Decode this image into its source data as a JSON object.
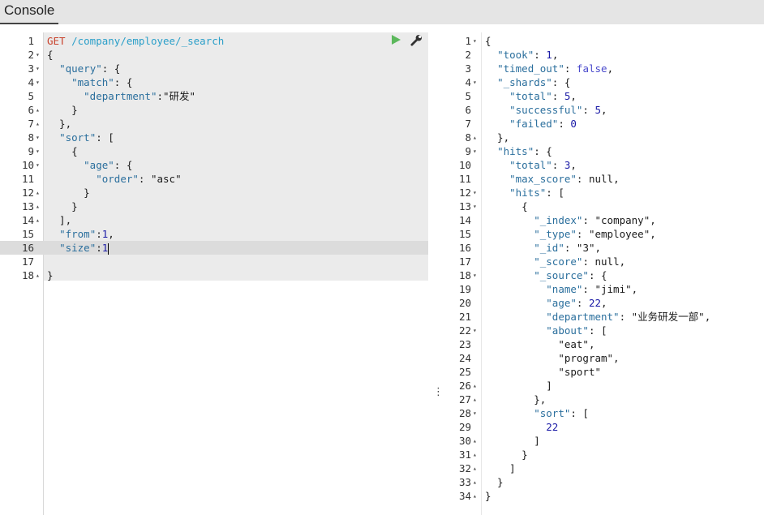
{
  "tabs": {
    "console_label": "Console"
  },
  "request": {
    "lines": [
      {
        "n": "1",
        "fold": "",
        "parts": [
          [
            "t-method",
            "GET"
          ],
          [
            "t-punc",
            " "
          ],
          [
            "t-url",
            "/company/employee/_search"
          ]
        ]
      },
      {
        "n": "2",
        "fold": "▾",
        "parts": [
          [
            "t-punc",
            "{"
          ]
        ]
      },
      {
        "n": "3",
        "fold": "▾",
        "parts": [
          [
            "t-punc",
            "  "
          ],
          [
            "t-key",
            "\"query\""
          ],
          [
            "t-punc",
            ": {"
          ]
        ]
      },
      {
        "n": "4",
        "fold": "▾",
        "parts": [
          [
            "t-punc",
            "    "
          ],
          [
            "t-key",
            "\"match\""
          ],
          [
            "t-punc",
            ": {"
          ]
        ]
      },
      {
        "n": "5",
        "fold": "",
        "parts": [
          [
            "t-punc",
            "      "
          ],
          [
            "t-key",
            "\"department\""
          ],
          [
            "t-punc",
            ":"
          ],
          [
            "t-str",
            "\"研发\""
          ]
        ]
      },
      {
        "n": "6",
        "fold": "▴",
        "parts": [
          [
            "t-punc",
            "    }"
          ]
        ]
      },
      {
        "n": "7",
        "fold": "▴",
        "parts": [
          [
            "t-punc",
            "  },"
          ]
        ]
      },
      {
        "n": "8",
        "fold": "▾",
        "parts": [
          [
            "t-punc",
            "  "
          ],
          [
            "t-key",
            "\"sort\""
          ],
          [
            "t-punc",
            ": ["
          ]
        ]
      },
      {
        "n": "9",
        "fold": "▾",
        "parts": [
          [
            "t-punc",
            "    {"
          ]
        ]
      },
      {
        "n": "10",
        "fold": "▾",
        "parts": [
          [
            "t-punc",
            "      "
          ],
          [
            "t-key",
            "\"age\""
          ],
          [
            "t-punc",
            ": {"
          ]
        ]
      },
      {
        "n": "11",
        "fold": "",
        "parts": [
          [
            "t-punc",
            "        "
          ],
          [
            "t-key",
            "\"order\""
          ],
          [
            "t-punc",
            ": "
          ],
          [
            "t-str",
            "\"asc\""
          ]
        ]
      },
      {
        "n": "12",
        "fold": "▴",
        "parts": [
          [
            "t-punc",
            "      }"
          ]
        ]
      },
      {
        "n": "13",
        "fold": "▴",
        "parts": [
          [
            "t-punc",
            "    }"
          ]
        ]
      },
      {
        "n": "14",
        "fold": "▴",
        "parts": [
          [
            "t-punc",
            "  ],"
          ]
        ]
      },
      {
        "n": "15",
        "fold": "",
        "parts": [
          [
            "t-punc",
            "  "
          ],
          [
            "t-key",
            "\"from\""
          ],
          [
            "t-punc",
            ":"
          ],
          [
            "t-num",
            "1"
          ],
          [
            "t-punc",
            ","
          ]
        ]
      },
      {
        "n": "16",
        "fold": "",
        "parts": [
          [
            "t-punc",
            "  "
          ],
          [
            "t-key",
            "\"size\""
          ],
          [
            "t-punc",
            ":"
          ],
          [
            "t-num",
            "1"
          ]
        ],
        "cursor": true,
        "highlight": true
      },
      {
        "n": "17",
        "fold": "",
        "parts": []
      },
      {
        "n": "18",
        "fold": "▴",
        "parts": [
          [
            "t-punc",
            "}"
          ]
        ]
      }
    ]
  },
  "response": {
    "lines": [
      {
        "n": "1",
        "fold": "▾",
        "parts": [
          [
            "t-punc",
            "{"
          ]
        ]
      },
      {
        "n": "2",
        "fold": "",
        "parts": [
          [
            "t-punc",
            "  "
          ],
          [
            "t-key",
            "\"took\""
          ],
          [
            "t-punc",
            ": "
          ],
          [
            "t-num",
            "1"
          ],
          [
            "t-punc",
            ","
          ]
        ]
      },
      {
        "n": "3",
        "fold": "",
        "parts": [
          [
            "t-punc",
            "  "
          ],
          [
            "t-key",
            "\"timed_out\""
          ],
          [
            "t-punc",
            ": "
          ],
          [
            "t-bool",
            "false"
          ],
          [
            "t-punc",
            ","
          ]
        ]
      },
      {
        "n": "4",
        "fold": "▾",
        "parts": [
          [
            "t-punc",
            "  "
          ],
          [
            "t-key",
            "\"_shards\""
          ],
          [
            "t-punc",
            ": {"
          ]
        ]
      },
      {
        "n": "5",
        "fold": "",
        "parts": [
          [
            "t-punc",
            "    "
          ],
          [
            "t-key",
            "\"total\""
          ],
          [
            "t-punc",
            ": "
          ],
          [
            "t-num",
            "5"
          ],
          [
            "t-punc",
            ","
          ]
        ]
      },
      {
        "n": "6",
        "fold": "",
        "parts": [
          [
            "t-punc",
            "    "
          ],
          [
            "t-key",
            "\"successful\""
          ],
          [
            "t-punc",
            ": "
          ],
          [
            "t-num",
            "5"
          ],
          [
            "t-punc",
            ","
          ]
        ]
      },
      {
        "n": "7",
        "fold": "",
        "parts": [
          [
            "t-punc",
            "    "
          ],
          [
            "t-key",
            "\"failed\""
          ],
          [
            "t-punc",
            ": "
          ],
          [
            "t-num",
            "0"
          ]
        ]
      },
      {
        "n": "8",
        "fold": "▴",
        "parts": [
          [
            "t-punc",
            "  },"
          ]
        ]
      },
      {
        "n": "9",
        "fold": "▾",
        "parts": [
          [
            "t-punc",
            "  "
          ],
          [
            "t-key",
            "\"hits\""
          ],
          [
            "t-punc",
            ": {"
          ]
        ]
      },
      {
        "n": "10",
        "fold": "",
        "parts": [
          [
            "t-punc",
            "    "
          ],
          [
            "t-key",
            "\"total\""
          ],
          [
            "t-punc",
            ": "
          ],
          [
            "t-num",
            "3"
          ],
          [
            "t-punc",
            ","
          ]
        ]
      },
      {
        "n": "11",
        "fold": "",
        "parts": [
          [
            "t-punc",
            "    "
          ],
          [
            "t-key",
            "\"max_score\""
          ],
          [
            "t-punc",
            ": "
          ],
          [
            "t-null",
            "null"
          ],
          [
            "t-punc",
            ","
          ]
        ]
      },
      {
        "n": "12",
        "fold": "▾",
        "parts": [
          [
            "t-punc",
            "    "
          ],
          [
            "t-key",
            "\"hits\""
          ],
          [
            "t-punc",
            ": ["
          ]
        ]
      },
      {
        "n": "13",
        "fold": "▾",
        "parts": [
          [
            "t-punc",
            "      {"
          ]
        ]
      },
      {
        "n": "14",
        "fold": "",
        "parts": [
          [
            "t-punc",
            "        "
          ],
          [
            "t-key",
            "\"_index\""
          ],
          [
            "t-punc",
            ": "
          ],
          [
            "t-str",
            "\"company\""
          ],
          [
            "t-punc",
            ","
          ]
        ]
      },
      {
        "n": "15",
        "fold": "",
        "parts": [
          [
            "t-punc",
            "        "
          ],
          [
            "t-key",
            "\"_type\""
          ],
          [
            "t-punc",
            ": "
          ],
          [
            "t-str",
            "\"employee\""
          ],
          [
            "t-punc",
            ","
          ]
        ]
      },
      {
        "n": "16",
        "fold": "",
        "parts": [
          [
            "t-punc",
            "        "
          ],
          [
            "t-key",
            "\"_id\""
          ],
          [
            "t-punc",
            ": "
          ],
          [
            "t-str",
            "\"3\""
          ],
          [
            "t-punc",
            ","
          ]
        ]
      },
      {
        "n": "17",
        "fold": "",
        "parts": [
          [
            "t-punc",
            "        "
          ],
          [
            "t-key",
            "\"_score\""
          ],
          [
            "t-punc",
            ": "
          ],
          [
            "t-null",
            "null"
          ],
          [
            "t-punc",
            ","
          ]
        ]
      },
      {
        "n": "18",
        "fold": "▾",
        "parts": [
          [
            "t-punc",
            "        "
          ],
          [
            "t-key",
            "\"_source\""
          ],
          [
            "t-punc",
            ": {"
          ]
        ]
      },
      {
        "n": "19",
        "fold": "",
        "parts": [
          [
            "t-punc",
            "          "
          ],
          [
            "t-key",
            "\"name\""
          ],
          [
            "t-punc",
            ": "
          ],
          [
            "t-str",
            "\"jimi\""
          ],
          [
            "t-punc",
            ","
          ]
        ]
      },
      {
        "n": "20",
        "fold": "",
        "parts": [
          [
            "t-punc",
            "          "
          ],
          [
            "t-key",
            "\"age\""
          ],
          [
            "t-punc",
            ": "
          ],
          [
            "t-num",
            "22"
          ],
          [
            "t-punc",
            ","
          ]
        ]
      },
      {
        "n": "21",
        "fold": "",
        "parts": [
          [
            "t-punc",
            "          "
          ],
          [
            "t-key",
            "\"department\""
          ],
          [
            "t-punc",
            ": "
          ],
          [
            "t-str",
            "\"业务研发一部\""
          ],
          [
            "t-punc",
            ","
          ]
        ]
      },
      {
        "n": "22",
        "fold": "▾",
        "parts": [
          [
            "t-punc",
            "          "
          ],
          [
            "t-key",
            "\"about\""
          ],
          [
            "t-punc",
            ": ["
          ]
        ]
      },
      {
        "n": "23",
        "fold": "",
        "parts": [
          [
            "t-punc",
            "            "
          ],
          [
            "t-str",
            "\"eat\""
          ],
          [
            "t-punc",
            ","
          ]
        ]
      },
      {
        "n": "24",
        "fold": "",
        "parts": [
          [
            "t-punc",
            "            "
          ],
          [
            "t-str",
            "\"program\""
          ],
          [
            "t-punc",
            ","
          ]
        ]
      },
      {
        "n": "25",
        "fold": "",
        "parts": [
          [
            "t-punc",
            "            "
          ],
          [
            "t-str",
            "\"sport\""
          ]
        ]
      },
      {
        "n": "26",
        "fold": "▴",
        "parts": [
          [
            "t-punc",
            "          ]"
          ]
        ]
      },
      {
        "n": "27",
        "fold": "▴",
        "parts": [
          [
            "t-punc",
            "        },"
          ]
        ]
      },
      {
        "n": "28",
        "fold": "▾",
        "parts": [
          [
            "t-punc",
            "        "
          ],
          [
            "t-key",
            "\"sort\""
          ],
          [
            "t-punc",
            ": ["
          ]
        ]
      },
      {
        "n": "29",
        "fold": "",
        "parts": [
          [
            "t-punc",
            "          "
          ],
          [
            "t-num",
            "22"
          ]
        ]
      },
      {
        "n": "30",
        "fold": "▴",
        "parts": [
          [
            "t-punc",
            "        ]"
          ]
        ]
      },
      {
        "n": "31",
        "fold": "▴",
        "parts": [
          [
            "t-punc",
            "      }"
          ]
        ]
      },
      {
        "n": "32",
        "fold": "▴",
        "parts": [
          [
            "t-punc",
            "    ]"
          ]
        ]
      },
      {
        "n": "33",
        "fold": "▴",
        "parts": [
          [
            "t-punc",
            "  }"
          ]
        ]
      },
      {
        "n": "34",
        "fold": "▴",
        "parts": [
          [
            "t-punc",
            "}"
          ]
        ]
      }
    ]
  },
  "colors": {
    "run_green": "#5cb85c",
    "method_red": "#c8412b",
    "url_blue": "#2b9fc9"
  }
}
